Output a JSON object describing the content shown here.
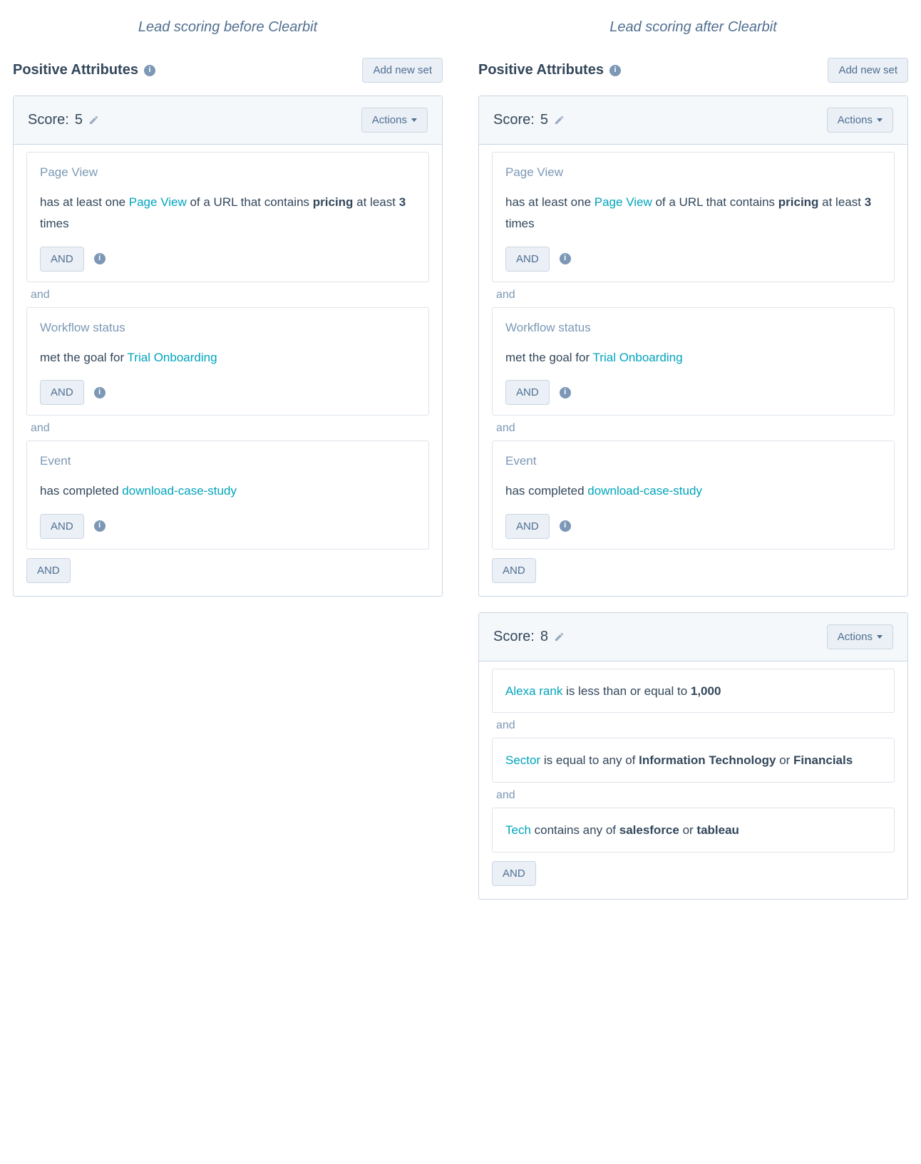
{
  "labels": {
    "and_sep": "and",
    "and_btn": "AND",
    "actions_btn": "Actions",
    "score_prefix": "Score: "
  },
  "columns": [
    {
      "title": "Lead scoring before Clearbit",
      "section_title": "Positive Attributes",
      "add_new_set": "Add new set",
      "cards": [
        {
          "score": "5",
          "filters": [
            {
              "label": "Page View",
              "tokens": [
                {
                  "text": "has at least one "
                },
                {
                  "text": "Page View",
                  "link": true
                },
                {
                  "text": " of a URL that contains "
                },
                {
                  "text": "pricing",
                  "bold": true
                },
                {
                  "text": " at least "
                },
                {
                  "text": "3",
                  "bold": true
                },
                {
                  "text": " times"
                }
              ],
              "show_and": true,
              "show_info": true
            },
            {
              "label": "Workflow status",
              "tokens": [
                {
                  "text": "met the goal for "
                },
                {
                  "text": "Trial Onboarding",
                  "link": true
                }
              ],
              "show_and": true,
              "show_info": true
            },
            {
              "label": "Event",
              "tokens": [
                {
                  "text": "has completed "
                },
                {
                  "text": "download-case-study",
                  "link": true
                }
              ],
              "show_and": true,
              "show_info": true
            }
          ],
          "footer_and": true
        }
      ]
    },
    {
      "title": "Lead scoring after Clearbit",
      "section_title": "Positive Attributes",
      "add_new_set": "Add new set",
      "cards": [
        {
          "score": "5",
          "filters": [
            {
              "label": "Page View",
              "tokens": [
                {
                  "text": "has at least one "
                },
                {
                  "text": "Page View",
                  "link": true
                },
                {
                  "text": " of a URL that contains "
                },
                {
                  "text": "pricing",
                  "bold": true
                },
                {
                  "text": " at least "
                },
                {
                  "text": "3",
                  "bold": true
                },
                {
                  "text": " times"
                }
              ],
              "show_and": true,
              "show_info": true
            },
            {
              "label": "Workflow status",
              "tokens": [
                {
                  "text": "met the goal for "
                },
                {
                  "text": "Trial Onboarding",
                  "link": true
                }
              ],
              "show_and": true,
              "show_info": true
            },
            {
              "label": "Event",
              "tokens": [
                {
                  "text": "has completed "
                },
                {
                  "text": "download-case-study",
                  "link": true
                }
              ],
              "show_and": true,
              "show_info": true
            }
          ],
          "footer_and": true
        },
        {
          "score": "8",
          "filters": [
            {
              "label": "",
              "tokens": [
                {
                  "text": "Alexa rank",
                  "link": true
                },
                {
                  "text": " is less than or equal to "
                },
                {
                  "text": "1,000",
                  "bold": true
                }
              ],
              "show_and": false,
              "show_info": false
            },
            {
              "label": "",
              "tokens": [
                {
                  "text": "Sector",
                  "link": true
                },
                {
                  "text": " is equal to any of "
                },
                {
                  "text": "Information Technology",
                  "bold": true
                },
                {
                  "text": " or "
                },
                {
                  "text": "Financials",
                  "bold": true
                }
              ],
              "show_and": false,
              "show_info": false
            },
            {
              "label": "",
              "tokens": [
                {
                  "text": "Tech",
                  "link": true
                },
                {
                  "text": " contains any of "
                },
                {
                  "text": "salesforce",
                  "bold": true
                },
                {
                  "text": " or "
                },
                {
                  "text": "tableau",
                  "bold": true
                }
              ],
              "show_and": false,
              "show_info": false
            }
          ],
          "footer_and": true
        }
      ]
    }
  ]
}
